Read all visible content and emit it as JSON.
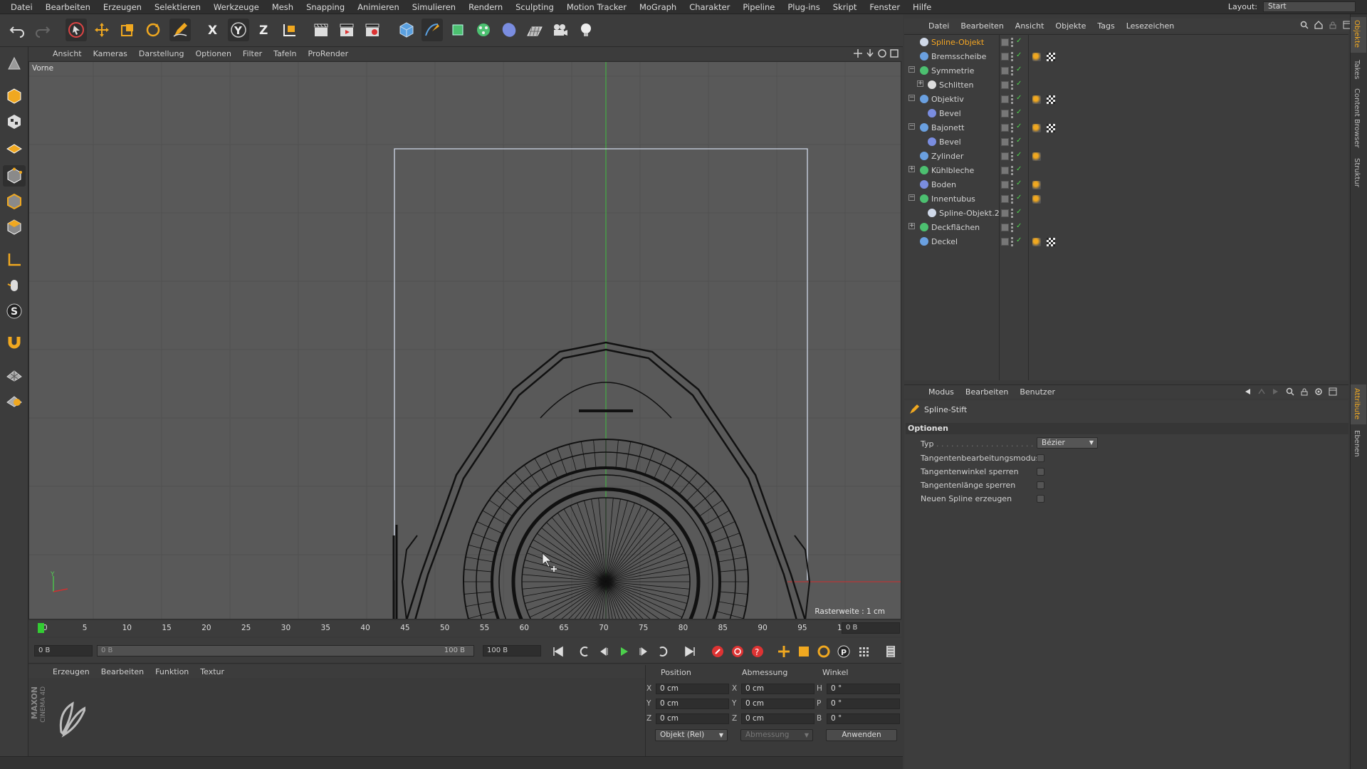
{
  "menubar": {
    "items": [
      "Datei",
      "Bearbeiten",
      "Erzeugen",
      "Selektieren",
      "Werkzeuge",
      "Mesh",
      "Snapping",
      "Animieren",
      "Simulieren",
      "Rendern",
      "Sculpting",
      "Motion Tracker",
      "MoGraph",
      "Charakter",
      "Pipeline",
      "Plug-ins",
      "Skript",
      "Fenster",
      "Hilfe"
    ],
    "layout_label": "Layout:",
    "layout_value": "Start"
  },
  "viewport": {
    "menu": [
      "Ansicht",
      "Kameras",
      "Darstellung",
      "Optionen",
      "Filter",
      "Tafeln",
      "ProRender"
    ],
    "camera_label": "Vorne",
    "grid_label": "Rasterweite : 1 cm",
    "axis_y": "Y",
    "axis_z": "Z"
  },
  "timeline": {
    "ticks": [
      "0",
      "5",
      "10",
      "15",
      "20",
      "25",
      "30",
      "35",
      "40",
      "45",
      "50",
      "55",
      "60",
      "65",
      "70",
      "75",
      "80",
      "85",
      "90",
      "95",
      "100"
    ],
    "current_frame_right": "0 B",
    "start_field": "0 B",
    "slider_left": "0 B",
    "slider_right": "100 B",
    "end_field": "100 B"
  },
  "material_manager": {
    "menu": [
      "Erzeugen",
      "Bearbeiten",
      "Funktion",
      "Textur"
    ],
    "brand_top": "MAXON",
    "brand_bottom": "CINEMA 4D"
  },
  "coordinates": {
    "headers": {
      "position": "Position",
      "size": "Abmessung",
      "rotation": "Winkel"
    },
    "pos_labels": [
      "X",
      "Y",
      "Z"
    ],
    "size_labels": [
      "X",
      "Y",
      "Z"
    ],
    "rot_labels": [
      "H",
      "P",
      "B"
    ],
    "pos_values": [
      "0 cm",
      "0 cm",
      "0 cm"
    ],
    "size_values": [
      "0 cm",
      "0 cm",
      "0 cm"
    ],
    "rot_values": [
      "0 °",
      "0 °",
      "0 °"
    ],
    "mode_select": "Objekt (Rel)",
    "size_select": "Abmessung",
    "apply_button": "Anwenden"
  },
  "object_manager": {
    "menu": [
      "Datei",
      "Bearbeiten",
      "Ansicht",
      "Objekte",
      "Tags",
      "Lesezeichen"
    ],
    "objects": [
      {
        "name": "Spline-Objekt",
        "indent": 0,
        "selected": true,
        "icon": "spline-icon",
        "expand": "",
        "tags": false
      },
      {
        "name": "Bremsscheibe",
        "indent": 0,
        "selected": false,
        "icon": "sweep-icon",
        "expand": "",
        "tags": true
      },
      {
        "name": "Symmetrie",
        "indent": 0,
        "selected": false,
        "icon": "symmetry-icon",
        "expand": "−",
        "tags": false
      },
      {
        "name": "Schlitten",
        "indent": 1,
        "selected": false,
        "icon": "null-icon",
        "expand": "+",
        "tags": false
      },
      {
        "name": "Objektiv",
        "indent": 0,
        "selected": false,
        "icon": "lathe-icon",
        "expand": "−",
        "tags": true
      },
      {
        "name": "Bevel",
        "indent": 1,
        "selected": false,
        "icon": "bevel-icon",
        "expand": "",
        "tags": false
      },
      {
        "name": "Bajonett",
        "indent": 0,
        "selected": false,
        "icon": "lathe-icon",
        "expand": "−",
        "tags": true
      },
      {
        "name": "Bevel",
        "indent": 1,
        "selected": false,
        "icon": "bevel-icon",
        "expand": "",
        "tags": false
      },
      {
        "name": "Zylinder",
        "indent": 0,
        "selected": false,
        "icon": "cylinder-icon",
        "expand": "",
        "tags": false
      },
      {
        "name": "Kühlbleche",
        "indent": 0,
        "selected": false,
        "icon": "cloner-icon",
        "expand": "+",
        "tags": false
      },
      {
        "name": "Boden",
        "indent": 0,
        "selected": false,
        "icon": "bevel-icon",
        "expand": "",
        "tags": false
      },
      {
        "name": "Innentubus",
        "indent": 0,
        "selected": false,
        "icon": "boole-icon",
        "expand": "−",
        "tags": false
      },
      {
        "name": "Spline-Objekt.2",
        "indent": 1,
        "selected": false,
        "icon": "spline-icon",
        "expand": "",
        "tags": false
      },
      {
        "name": "Deckflächen",
        "indent": 0,
        "selected": false,
        "icon": "cloner-icon",
        "expand": "+",
        "tags": false
      },
      {
        "name": "Deckel",
        "indent": 0,
        "selected": false,
        "icon": "lathe-icon",
        "expand": "",
        "tags": true
      }
    ]
  },
  "attributes": {
    "menu": [
      "Modus",
      "Bearbeiten",
      "Benutzer"
    ],
    "tool_name": "Spline-Stift",
    "section": "Optionen",
    "type_label": "Typ",
    "type_value": "Bézier",
    "options": [
      {
        "label": "Tangentenbearbeitungsmodus",
        "checked": false
      },
      {
        "label": "Tangentenwinkel sperren",
        "checked": false
      },
      {
        "label": "Tangentenlänge sperren",
        "checked": false
      },
      {
        "label": "Neuen Spline erzeugen",
        "checked": false
      }
    ]
  },
  "side_tabs": {
    "right_top": [
      "Objekte",
      "Takes",
      "Content Browser",
      "Struktur"
    ],
    "right_bottom": [
      "Attribute",
      "Ebenen"
    ]
  },
  "colors": {
    "accent": "#f5a623",
    "viewport_bg": "#595959",
    "y_axis": "#3fbf3f",
    "x_axis": "#d03030",
    "wire": "#111111",
    "frame": "#cfd8e8"
  }
}
